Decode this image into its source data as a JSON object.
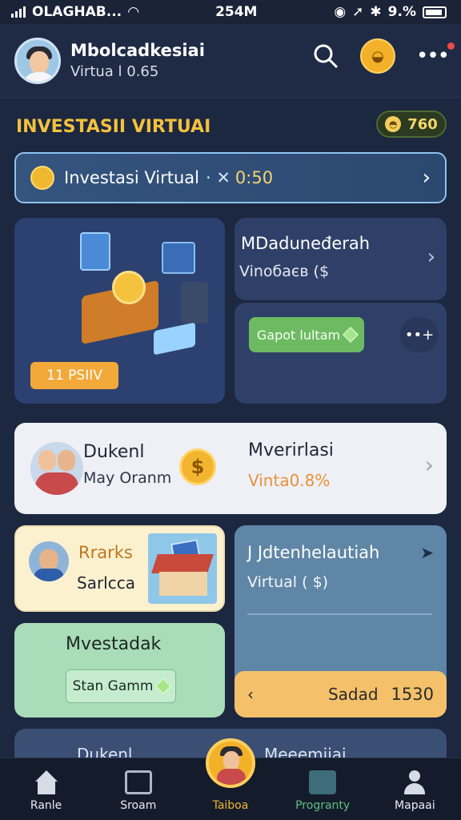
{
  "status_bar": {
    "carrier": "OLAGHAB...",
    "time": "254M",
    "battery": "9.%"
  },
  "header": {
    "name": "Mbolcadkesiai",
    "subtitle": "Virtua l 0.65"
  },
  "section": {
    "title": "INVESTASII VIRTUAI",
    "coins": "760"
  },
  "banner": {
    "label": "Investasi Virtual",
    "separator": "· ✕",
    "value": "0:50"
  },
  "feature_card": {
    "badge": "11 PSIIV"
  },
  "right_card_top": {
    "title": "MDaduneđerah",
    "subtitle": "Vinoбаєв ($"
  },
  "right_card_bottom": {
    "button": "Gapot lultam",
    "more": "••+"
  },
  "profile_card": {
    "name": "Dukenl",
    "role": "May Oranm",
    "title": "Mverirlasi",
    "value": "Vinta0.8%"
  },
  "stocks_card": {
    "title": "Rrarks",
    "subtitle": "Sarlcca"
  },
  "right_tall_card": {
    "title": "J Jdtenhelautiah",
    "subtitle": "Virtual ( $)",
    "footer_label": "Sadad",
    "footer_value": "1530"
  },
  "mvest_card": {
    "title": "Mvestadak",
    "button": "Stan Gamm"
  },
  "peek_card": {
    "left": "Dukenl",
    "right": "Meeemiiai"
  },
  "bottom_nav": [
    {
      "label": "Ranle"
    },
    {
      "label": "Sroam"
    },
    {
      "label": "Taiboa"
    },
    {
      "label": "Progranty"
    },
    {
      "label": "Mapaai"
    }
  ],
  "colors": {
    "accent": "#f3b52f",
    "background": "#1c2740",
    "green": "#6dba63"
  }
}
